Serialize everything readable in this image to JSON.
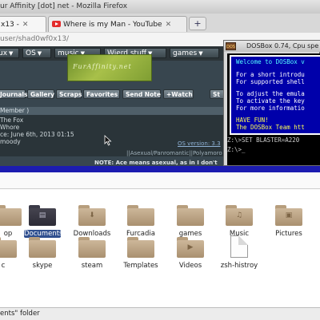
{
  "firefox": {
    "window_title": "ur Affinity [dot] net - Mozilla Firefox",
    "tabs": [
      {
        "label": "x13 -",
        "close": "✕"
      },
      {
        "label": "Where is my Man - YouTube",
        "close": "✕"
      }
    ],
    "new_tab": "+",
    "url": "user/shad0wf0x13/"
  },
  "page": {
    "menus": [
      "ux",
      "OS",
      "music",
      "Wierd stuff",
      "games"
    ],
    "caret": "▼",
    "banner_text": "FurAffinity.net",
    "profile_tabs": [
      "Journals",
      "Gallery",
      "Scraps",
      "Favorites",
      "Send Note",
      "+Watch",
      "St"
    ],
    "member_header": "Member )",
    "member_lines": [
      "The Fox",
      "Whore",
      "ce: June 6th, 2013 01:15",
      "moody"
    ],
    "os_version": "OS version: 3.3",
    "asexual_line": "||Asexual/Panromantic||Polyamoro",
    "note_line": "NOTE: Ace means asexual, as in I don't"
  },
  "dosbox": {
    "title": "DOSBox 0.74, Cpu spe",
    "icon_text": "DOS",
    "lines": [
      {
        "text": "Welcome to DOSBox v",
        "color": "#55ffff"
      },
      {
        "text": "For a short introdu",
        "color": "#ffffff"
      },
      {
        "text": "For supported shell",
        "color": "#ffffff"
      },
      {
        "text": "To adjust the emula",
        "color": "#ffffff"
      },
      {
        "text": "To activate the key",
        "color": "#ffffff"
      },
      {
        "text": "For more informatio",
        "color": "#ffffff"
      },
      {
        "text": "HAVE FUN!",
        "color": "#ffff55"
      },
      {
        "text": "The DOSBox Team htt",
        "color": "#ffff55"
      }
    ],
    "commands": [
      "Z:\\>SET BLASTER=A220",
      "Z:\\>_"
    ]
  },
  "file_manager": {
    "row1": [
      {
        "label": "op",
        "glyph": ""
      },
      {
        "label": "Documents",
        "glyph": "▤",
        "selected": true
      },
      {
        "label": "Downloads",
        "glyph": "⬇"
      },
      {
        "label": "Furcadia",
        "glyph": ""
      },
      {
        "label": "games",
        "glyph": ""
      },
      {
        "label": "Music",
        "glyph": "♫"
      },
      {
        "label": "Pictures",
        "glyph": "▣"
      }
    ],
    "row2": [
      {
        "label": "c",
        "glyph": ""
      },
      {
        "label": "skype",
        "glyph": ""
      },
      {
        "label": "steam",
        "glyph": ""
      },
      {
        "label": "Templates",
        "glyph": ""
      },
      {
        "label": "Videos",
        "glyph": "▶"
      },
      {
        "label": "zsh-histroy",
        "glyph": ""
      }
    ],
    "status": "ents\" folder"
  }
}
